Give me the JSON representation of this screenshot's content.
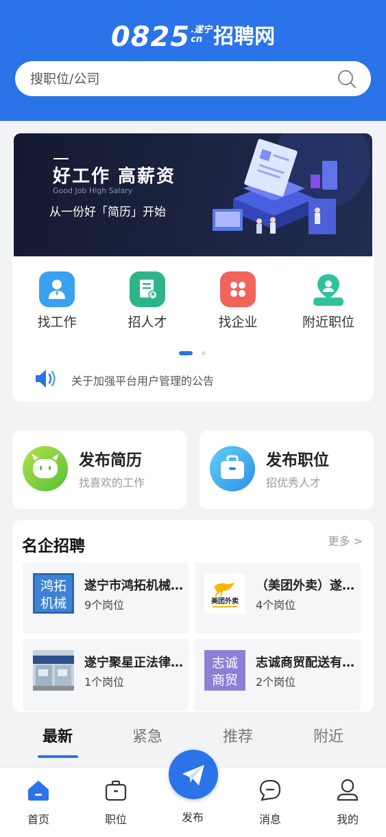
{
  "header": {
    "logo_number": "0825",
    "logo_domain_top": ".遂宁",
    "logo_domain_bottom": "cn",
    "logo_name": "招聘网",
    "search_placeholder": "搜职位/公司"
  },
  "banner": {
    "title": "好工作 高薪资",
    "subtitle_en": "Good Job  High Salary",
    "subtitle": "从一份好「简历」开始"
  },
  "quick_links": [
    {
      "label": "找工作",
      "icon": "person-icon",
      "color": "#3aa0f0"
    },
    {
      "label": "招人才",
      "icon": "resume-icon",
      "color": "#2fb48a"
    },
    {
      "label": "找企业",
      "icon": "grid-icon",
      "color": "#f0645a"
    },
    {
      "label": "附近职位",
      "icon": "location-pin-icon",
      "color": "#2fc29a"
    }
  ],
  "notice": {
    "text": "关于加强平台用户管理的公告"
  },
  "publish": [
    {
      "title": "发布简历",
      "subtitle": "找喜欢的工作",
      "icon": "face-icon"
    },
    {
      "title": "发布职位",
      "subtitle": "招优秀人才",
      "icon": "briefcase-icon"
    }
  ],
  "famous": {
    "title": "名企招聘",
    "more": "更多 >",
    "companies": [
      {
        "name": "遂宁市鸿拓机械有限公司",
        "jobs": "9个岗位",
        "logo_text": [
          "鸿拓",
          "机械"
        ]
      },
      {
        "name": "（美团外卖）遂宁站",
        "jobs": "4个岗位",
        "logo_text": [
          "美团外卖"
        ]
      },
      {
        "name": "遂宁聚星正法律咨询",
        "jobs": "1个岗位",
        "logo_text": []
      },
      {
        "name": "志诚商贸配送有限公司",
        "jobs": "2个岗位",
        "logo_text": [
          "志诚",
          "商贸"
        ]
      }
    ]
  },
  "tabs": [
    "最新",
    "紧急",
    "推荐",
    "附近"
  ],
  "bottom_nav": {
    "home": "首页",
    "jobs": "职位",
    "publish": "发布",
    "messages": "消息",
    "mine": "我的"
  },
  "colors": {
    "brand": "#2b73e8",
    "background": "#f2f3f5"
  }
}
